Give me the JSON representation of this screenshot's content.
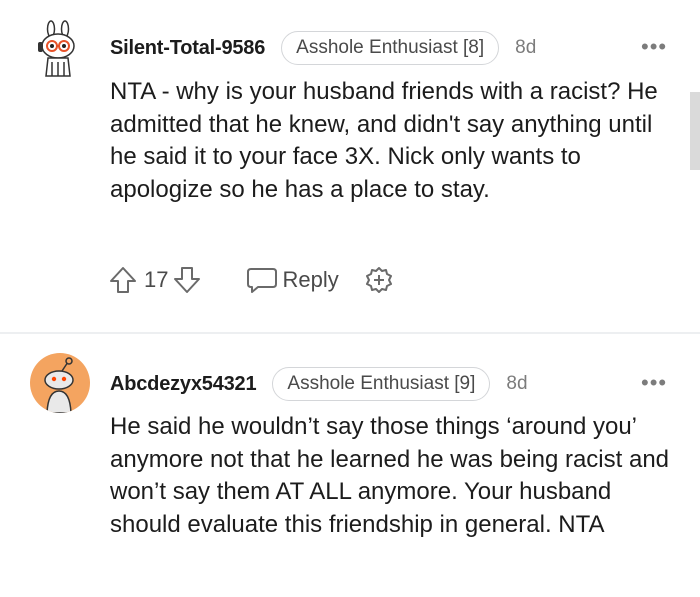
{
  "comments": [
    {
      "username": "Silent-Total-9586",
      "flair": "Asshole Enthusiast [8]",
      "time": "8d",
      "more": "•••",
      "body": "NTA - why is your husband friends with a racist? He admitted that he knew, and didn't say anything until he said it to your face 3X. Nick only wants to apologize so he has a place to stay.",
      "votes": "17",
      "reply_label": "Reply",
      "avatar_icon": "snoo-bunny-avatar-icon"
    },
    {
      "username": "Abcdezyx54321",
      "flair": "Asshole Enthusiast [9]",
      "time": "8d",
      "more": "•••",
      "body": "He said he wouldn’t say those things ‘around you’ anymore not that he learned he was being racist and won’t say them AT ALL anymore. Your husband should evaluate this friendship in general. NTA",
      "avatar_icon": "default-snoo-avatar-icon"
    }
  ],
  "colors": {
    "text": "#1c1c1c",
    "meta": "#7c7c7c",
    "avatar_bg": "#f4a460",
    "divider": "#edeff1"
  }
}
